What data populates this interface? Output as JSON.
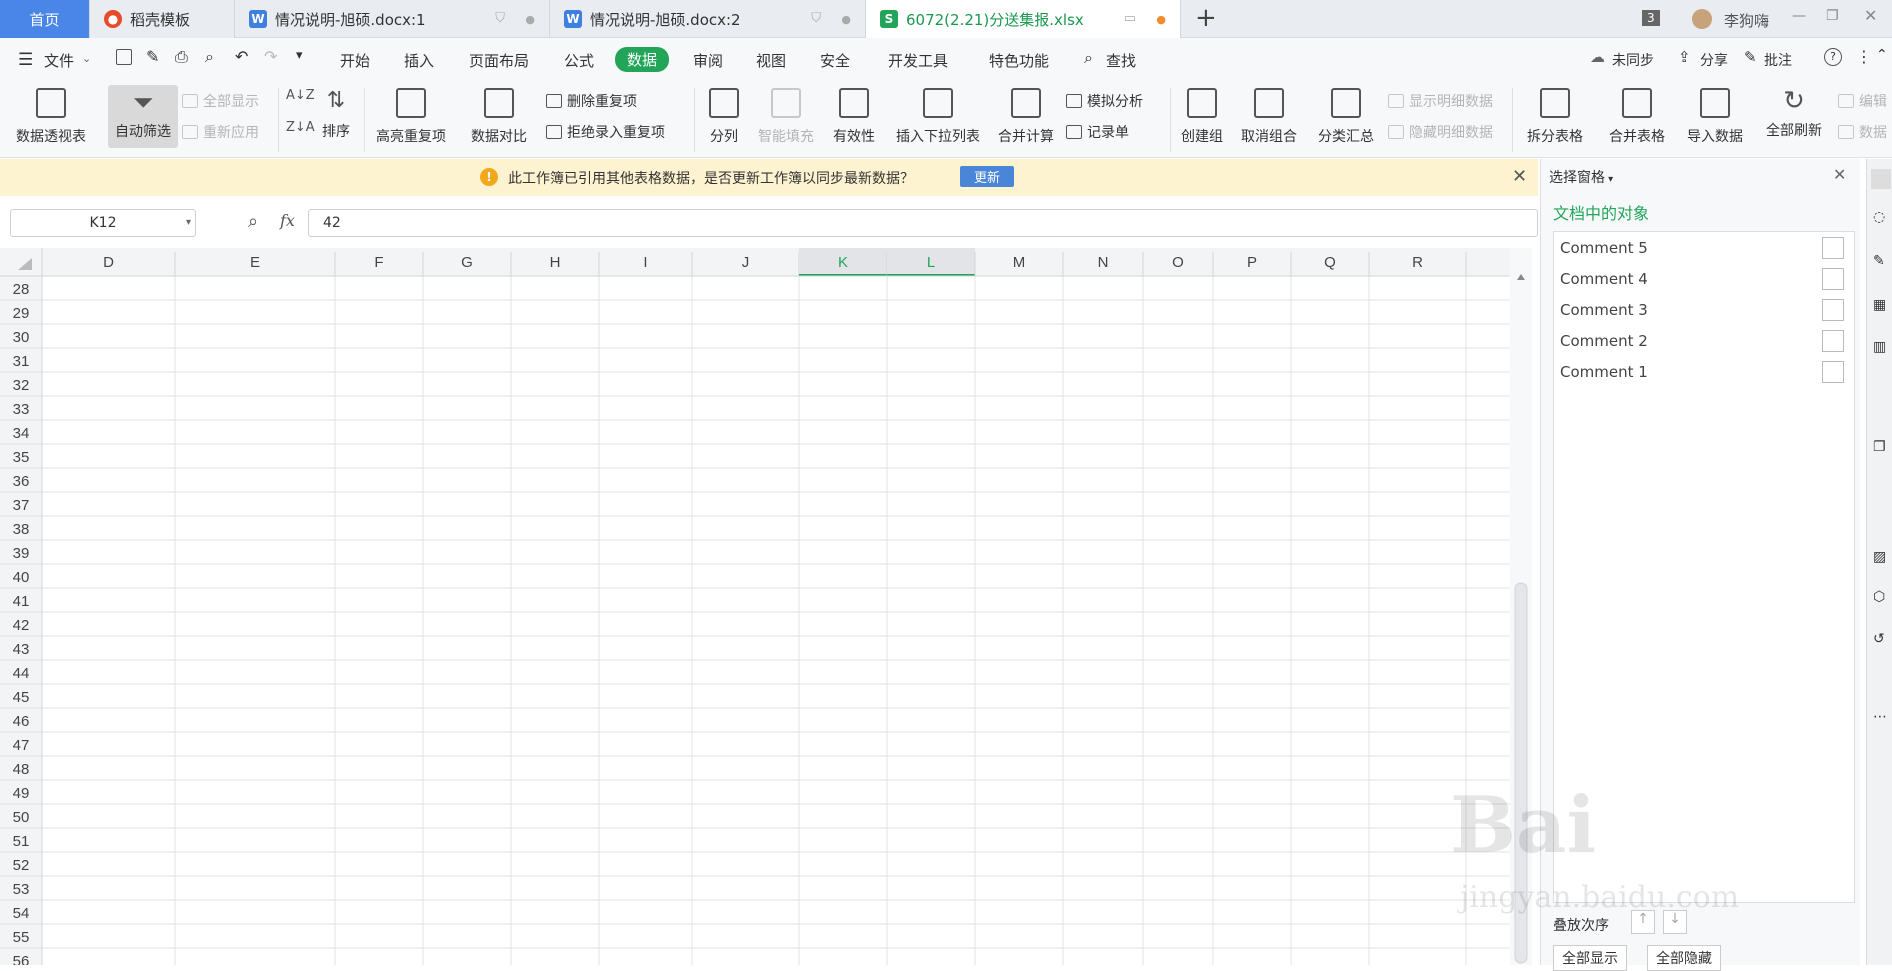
{
  "tabs": {
    "home": "首页",
    "t1": "稻壳模板",
    "t2": "情况说明-旭硕.docx:1",
    "t3": "情况说明-旭硕.docx:2",
    "t4": "6072(2.21)分送集报.xlsx",
    "new_tab": "+",
    "badge": "3",
    "user": "李狗嗨"
  },
  "menu": {
    "file": "文件",
    "items": [
      "开始",
      "插入",
      "页面布局",
      "公式",
      "数据",
      "审阅",
      "视图",
      "安全",
      "开发工具",
      "特色功能"
    ],
    "search": "查找",
    "sync": "未同步",
    "share": "分享",
    "comment": "批注"
  },
  "ribbon": {
    "pivot": "数据透视表",
    "autofilter": "自动筛选",
    "showall": "全部显示",
    "reapply": "重新应用",
    "sort": "排序",
    "highlight_dup": "高亮重复项",
    "compare": "数据对比",
    "remove_dup": "删除重复项",
    "reject_dup": "拒绝录入重复项",
    "split": "分列",
    "smartfill": "智能填充",
    "validity": "有效性",
    "dropdown": "插入下拉列表",
    "consolidate": "合并计算",
    "whatif": "模拟分析",
    "record": "记录单",
    "group": "创建组",
    "ungroup": "取消组合",
    "subtotal": "分类汇总",
    "show_detail": "显示明细数据",
    "hide_detail": "隐藏明细数据",
    "split_table": "拆分表格",
    "merge_table": "合并表格",
    "import": "导入数据",
    "refresh_all": "全部刷新",
    "edit": "编辑",
    "data": "数据"
  },
  "notice": {
    "text": "此工作簿已引用其他表格数据，是否更新工作簿以同步最新数据？",
    "button": "更新"
  },
  "formula": {
    "namebox": "K12",
    "fx": "fx",
    "value": "42"
  },
  "grid": {
    "columns": [
      "D",
      "E",
      "F",
      "G",
      "H",
      "I",
      "J",
      "K",
      "L",
      "M",
      "N",
      "O",
      "P",
      "Q",
      "R"
    ],
    "rows": [
      "28",
      "29",
      "30",
      "31",
      "32",
      "33",
      "34",
      "35",
      "36",
      "37",
      "38",
      "39",
      "40",
      "41",
      "42",
      "43",
      "44",
      "45",
      "46",
      "47",
      "48",
      "49",
      "50",
      "51",
      "52",
      "53",
      "54",
      "55",
      "56"
    ],
    "selected_cols": [
      "K",
      "L"
    ]
  },
  "pane": {
    "title": "选择窗格",
    "section": "文档中的对象",
    "objects": [
      "Comment 5",
      "Comment 4",
      "Comment 3",
      "Comment 2",
      "Comment 1"
    ],
    "order_label": "叠放次序",
    "show_all": "全部显示",
    "hide_all": "全部隐藏"
  },
  "colors": {
    "accent": "#22a559",
    "home_tab": "#4a86e8",
    "notice_bg": "#fdf3d0",
    "update_btn": "#4a86d8"
  }
}
